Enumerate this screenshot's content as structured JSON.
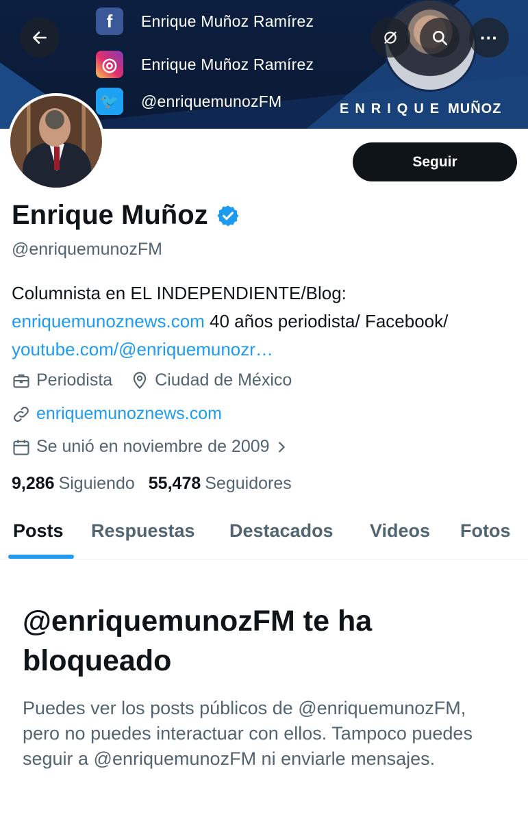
{
  "banner": {
    "social": [
      {
        "icon": "facebook-icon",
        "glyph": "f",
        "text": "Enrique Muñoz Ramírez"
      },
      {
        "icon": "instagram-icon",
        "glyph": "◎",
        "text": "Enrique Muñoz Ramírez"
      },
      {
        "icon": "twitter-icon",
        "glyph": "🐦",
        "text": "@enriquemunozFM"
      }
    ],
    "brand_first": "ENRIQUE",
    "brand_last": "MUÑOZ"
  },
  "nav": {
    "back_icon": "arrow-left-icon",
    "nofollow_icon": "link-off-icon",
    "search_icon": "search-icon",
    "more_icon": "more-icon",
    "more_glyph": "···"
  },
  "profile": {
    "display_name": "Enrique Muñoz",
    "verified": true,
    "handle": "@enriquemunozFM",
    "follow_label": "Seguir",
    "bio": {
      "part1": "Columnista en EL INDEPENDIENTE/Blog: ",
      "link1": "enriquemunoznews.com",
      "part2": " 40 años periodista/ Facebook/ ",
      "link2": "youtube.com/@enriquemunozr…"
    },
    "profession": "Periodista",
    "location": "Ciudad de México",
    "website": "enriquemunoznews.com",
    "joined": "Se unió en noviembre de 2009",
    "following_count": "9,286",
    "following_label": "Siguiendo",
    "followers_count": "55,478",
    "followers_label": "Seguidores"
  },
  "tabs": [
    "Posts",
    "Respuestas",
    "Destacados",
    "Videos",
    "Fotos"
  ],
  "active_tab": "Posts",
  "blocked": {
    "title": "@enriquemunozFM te ha bloqueado",
    "description": "Puedes ver los posts públicos de @enriquemunozFM, pero no puedes interactuar con ellos. Tampoco puedes seguir a @enriquemunozFM ni enviarle mensajes."
  },
  "colors": {
    "accent": "#1d9bf0",
    "text": "#0f1419",
    "secondary": "#536471",
    "banner": "#0d1f3f"
  }
}
